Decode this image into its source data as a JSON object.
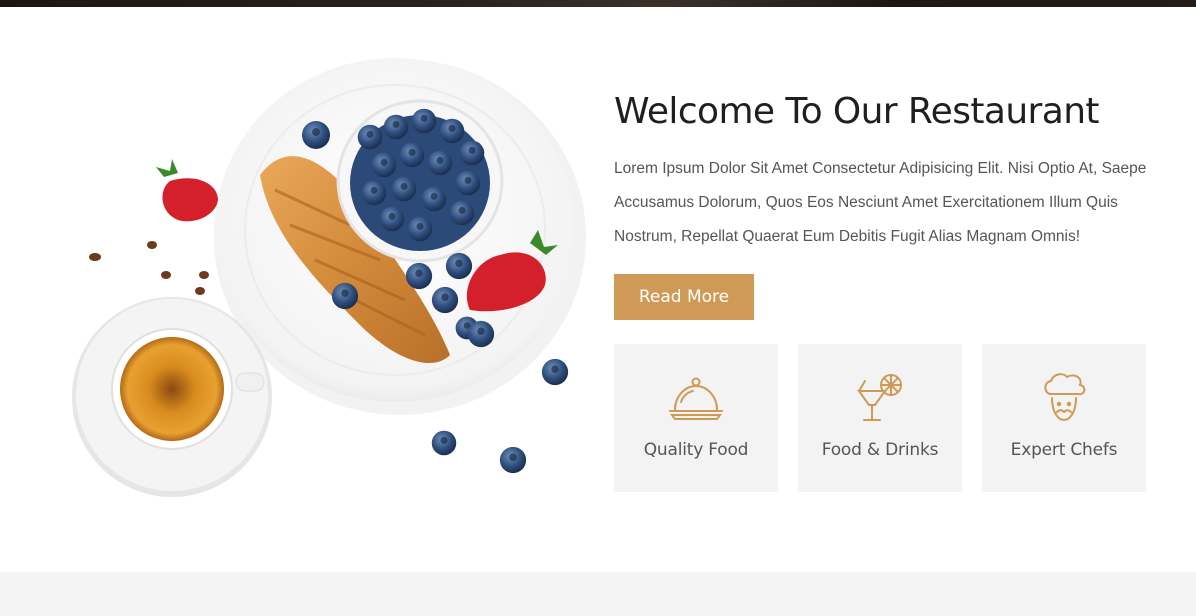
{
  "colors": {
    "accent": "#cf9a55",
    "title": "#1f1f1f",
    "body_text": "#555555",
    "tile_bg": "#f3f3f3"
  },
  "about": {
    "title": "Welcome To Our Restaurant",
    "description": "Lorem Ipsum Dolor Sit Amet Consectetur Adipisicing Elit. Nisi Optio At, Saepe Accusamus Dolorum, Quos Eos Nesciunt Amet Exercitationem Illum Quis Nostrum, Repellat Quaerat Eum Debitis Fugit Alias Magnam Omnis!",
    "read_more_label": "Read More"
  },
  "features": [
    {
      "label": "Quality Food",
      "icon": "cloche-icon"
    },
    {
      "label": "Food & Drinks",
      "icon": "cocktail-icon"
    },
    {
      "label": "Expert Chefs",
      "icon": "chef-icon"
    }
  ]
}
